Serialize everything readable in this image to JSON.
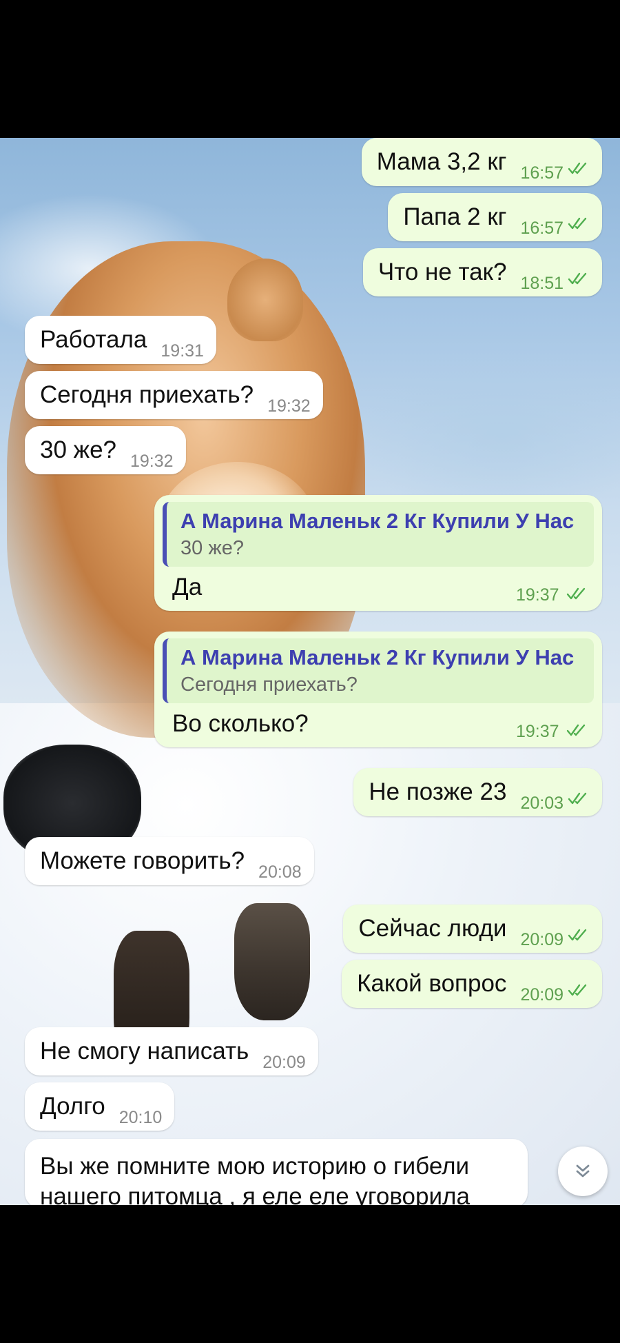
{
  "messages": [
    {
      "side": "out",
      "text": "Мама 3,2 кг",
      "time": "16:57",
      "read": true
    },
    {
      "side": "out",
      "text": "Папа 2 кг",
      "time": "16:57",
      "read": true
    },
    {
      "side": "out",
      "text": "Что не так?",
      "time": "18:51",
      "read": true
    },
    {
      "side": "in",
      "text": "Работала",
      "time": "19:31"
    },
    {
      "side": "in",
      "text": "Сегодня приехать?",
      "time": "19:32"
    },
    {
      "side": "in",
      "text": "30 же?",
      "time": "19:32"
    },
    {
      "side": "out",
      "reply_to": {
        "name": "А Марина Маленьк 2 Кг Купили У Нас",
        "text": "30 же?"
      },
      "text": "Да",
      "time": "19:37",
      "read": true
    },
    {
      "side": "out",
      "reply_to": {
        "name": "А Марина Маленьк 2 Кг Купили У Нас",
        "text": "Сегодня приехать?"
      },
      "text": "Во сколько?",
      "time": "19:37",
      "read": true
    },
    {
      "side": "out",
      "text": "Не позже 23",
      "time": "20:03",
      "read": true
    },
    {
      "side": "in",
      "text": "Можете говорить?",
      "time": "20:08"
    },
    {
      "side": "out",
      "text": "Сейчас люди",
      "time": "20:09",
      "read": true
    },
    {
      "side": "out",
      "text": "Какой вопрос",
      "time": "20:09",
      "read": true
    },
    {
      "side": "in",
      "text": "Не смогу написать",
      "time": "20:09"
    },
    {
      "side": "in",
      "text": "Долго",
      "time": "20:10"
    },
    {
      "side": "in",
      "text": "Вы же помните мою историю о гибели нашего питомца , я еле еле уговорила"
    }
  ],
  "colors": {
    "outgoing": "#effdde",
    "incoming": "#ffffff",
    "reply_accent": "#4a4fb5",
    "read_ticks": "#4fae4e"
  },
  "icons": {
    "read": "double-check-icon",
    "scroll": "chevron-double-down-icon"
  }
}
